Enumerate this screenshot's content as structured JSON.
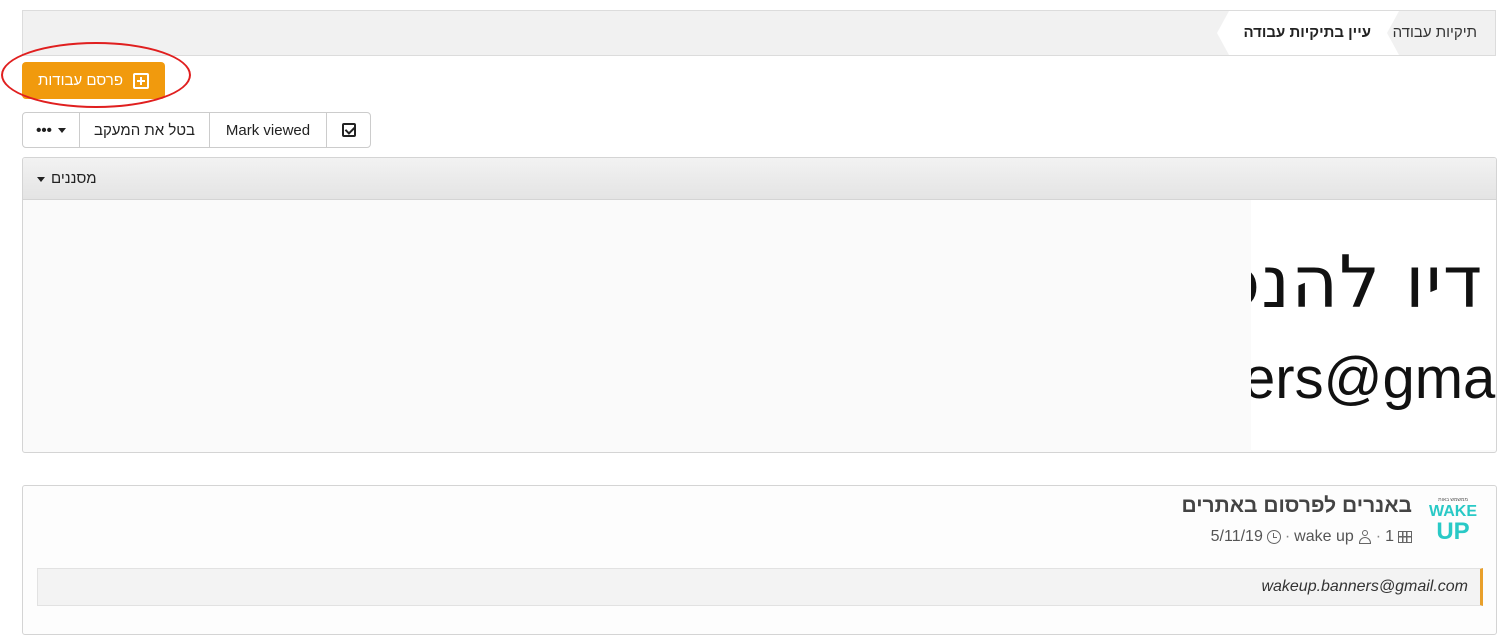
{
  "breadcrumb": {
    "root": "תיקיות עבודה",
    "current": "עיין בתיקיות עבודה"
  },
  "actions": {
    "publish_label": "פרסם עבודות"
  },
  "toolbar": {
    "mark_viewed": "Mark viewed",
    "untrack": "בטל את המעקב",
    "more": "•••"
  },
  "filters": {
    "title": "מסננים",
    "banner_line1": "דיו להנפ",
    "banner_line2": "ers@gmail"
  },
  "card": {
    "logo_tag": "ממשמש באות",
    "logo_wake": "WAKE",
    "logo_up": "UP",
    "title": "באנרים לפרסום באתרים",
    "count": "1",
    "owner": "wake up",
    "date": "5/11/19",
    "separator": "·",
    "description": "wakeup.banners@gmail.com"
  },
  "colors": {
    "accent": "#f19a0d",
    "annotation": "#e01f1f",
    "logo": "#29c9c6",
    "quote_border": "#e9a02b"
  }
}
